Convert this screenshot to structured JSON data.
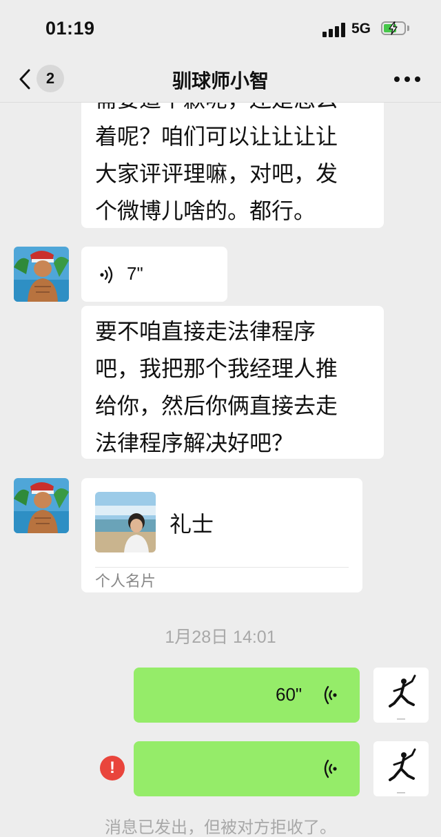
{
  "status_bar": {
    "time": "01:19",
    "network": "5G"
  },
  "nav": {
    "back_badge": "2",
    "title": "驯球师小智"
  },
  "messages": {
    "text_1": "需要道个歉呢，还是怎么\n着呢？咱们可以让让让让\n大家评评理嘛，对吧，发\n个微博儿啥的。都行。",
    "voice_in_duration": "7\"",
    "text_2": "要不咱直接走法律程序\n吧，我把那个我经理人推\n给你，然后你俩直接去走\n法律程序解决好吧？",
    "contact_card": {
      "name": "礼士",
      "label": "个人名片"
    },
    "timestamp": "1月28日 14:01",
    "voice_out_duration": "60\"",
    "error_mark": "!",
    "system_note": "消息已发出，但被对方拒收了。"
  },
  "icons": {
    "back": "chevron-left-icon",
    "more": "more-dots-icon",
    "voice_in": "voice-wave-icon",
    "voice_out": "voice-wave-icon",
    "error": "exclamation-icon"
  },
  "colors": {
    "background": "#ededed",
    "bubble_in": "#ffffff",
    "bubble_out": "#95ec69",
    "error": "#e9453c",
    "battery": "#46c74a"
  }
}
